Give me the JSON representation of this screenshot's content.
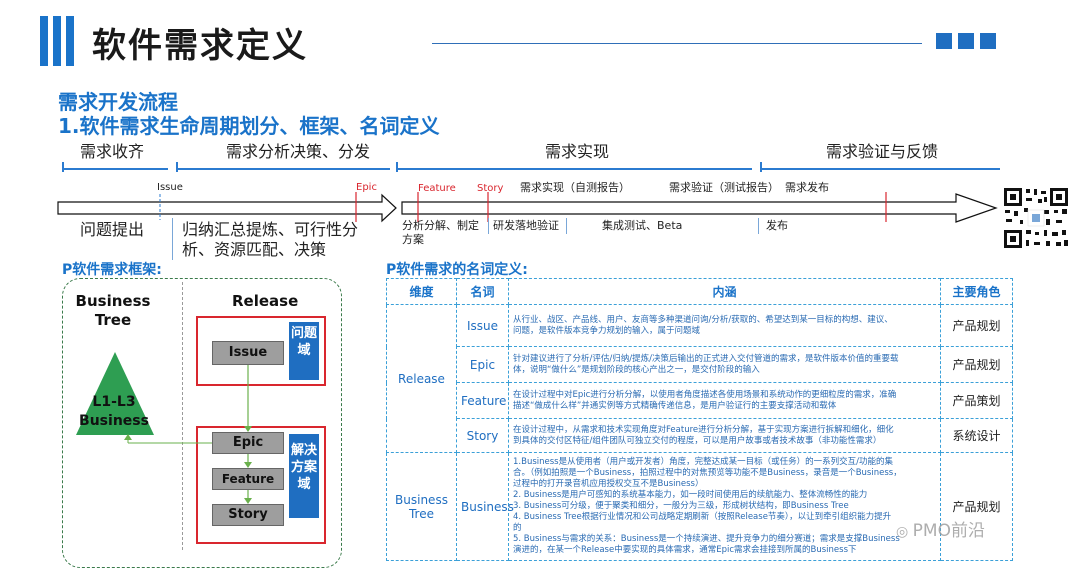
{
  "header": {
    "title": "软件需求定义",
    "section_title": "需求开发流程",
    "sub_title": "1.软件需求生命周期划分、框架、名词定义"
  },
  "timeline": {
    "phases": [
      "需求收齐",
      "需求分析决策、分发",
      "需求实现",
      "需求验证与反馈"
    ],
    "markers": {
      "issue": "Issue",
      "epic": "Epic",
      "feature": "Feature",
      "story": "Story"
    },
    "steps": {
      "impl_self_test": "需求实现（自测报告）",
      "verify_test": "需求验证（测试报告）",
      "release_req": "需求发布"
    },
    "below": {
      "raise": "问题提出",
      "summarize": "归纳汇总提炼、可行性分析、资源匹配、决策",
      "decompose": "分析分解、制定方案",
      "develop": "研发落地验证",
      "integrate": "集成测试、Beta",
      "publish": "发布"
    }
  },
  "framework": {
    "title": "P软件需求框架:",
    "business_tree": "Business Tree",
    "release": "Release",
    "triangle": "L1-L3 Business",
    "boxes": {
      "issue": "Issue",
      "epic": "Epic",
      "feature": "Feature",
      "story": "Story"
    },
    "tags": {
      "problem_domain": "问题域",
      "solution_domain": "解决方案域"
    }
  },
  "definitions": {
    "title": "P软件需求的名词定义:",
    "headers": [
      "维度",
      "名词",
      "内涵",
      "主要角色"
    ],
    "groups": [
      {
        "dimension": "Release",
        "rows": [
          {
            "term": "Issue",
            "desc": [
              "从行业、战区、产品线、用户、友商等多种渠道问询/分析/获取的、希望达到某一目标的构想、建议、",
              "问题，是软件版本竞争力规划的输入，属于问题域"
            ],
            "role": "产品规划"
          },
          {
            "term": "Epic",
            "desc": [
              "针对建议进行了分析/评估/归纳/提炼/决策后输出的正式进入交付管道的需求，是软件版本价值的重要载",
              "体，说明“做什么”是规划阶段的核心产出之一，是交付阶段的输入"
            ],
            "role": "产品规划"
          },
          {
            "term": "Feature",
            "desc": [
              "在设计过程中对Epic进行分析分解，以使用者角度描述各使用场景和系统动作的更细粒度的需求，准确",
              "描述“做成什么样”并通实例等方式精确传递信息，是用户验证行的主要支撑活动和载体"
            ],
            "role": "产品策划"
          },
          {
            "term": "Story",
            "desc": [
              "在设计过程中，从需求和技术实现角度对Feature进行分析分解，基于实现方案进行拆解和细化，细化",
              "到具体的交付区特征/组件团队可独立交付的程度，可以是用户故事或者技术故事（非功能性需求）"
            ],
            "role": "系统设计"
          }
        ]
      },
      {
        "dimension": "Business Tree",
        "rows": [
          {
            "term": "Business",
            "desc": [
              "1.Business是从使用者（用户或开发者）角度，完整达成某一目标（或任务）的一系列交互/功能的集",
              "合。（例如拍照是一个Business，拍照过程中的对焦预览等功能不是Business，录音是一个Business，",
              "过程中的打开录音机应用授权交互不是Business）",
              "2. Business是用户可感知的系统基本能力，如一段时间使用后的续航能力、整体流畅性的能力",
              "3. Business可分级，便于聚类和细分，一般分为三级，形成树状结构，即Business Tree",
              "4. Business Tree根据行业情况和公司战略定期刷新（按照Release节奏），以让到牵引组织能力提升",
              "的",
              "5. Business与需求的关系：Business是一个持续演进、提升竞争力的细分赛道；需求是支撑Business",
              "演进的，在某一个Release中要实现的具体需求，通常Epic需求会挂接到所属的Business下"
            ],
            "role": "产品规划"
          }
        ]
      }
    ]
  },
  "watermark": "PMO前沿",
  "colors": {
    "accent": "#1a73c9",
    "red": "#d9262e",
    "gray_box": "#9e9e9e"
  }
}
